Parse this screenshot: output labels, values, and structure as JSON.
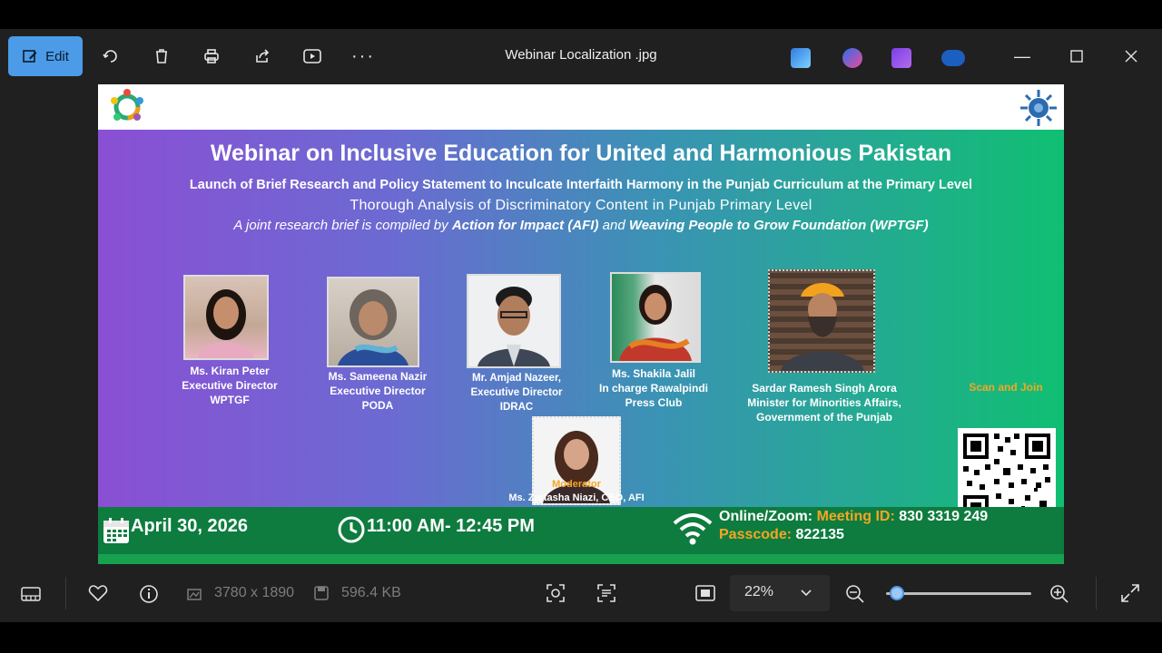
{
  "window": {
    "title": "Webinar Localization .jpg"
  },
  "toolbar": {
    "edit_label": "Edit"
  },
  "image": {
    "title": "Webinar on Inclusive Education for United and Harmonious Pakistan",
    "subtitle": "Launch of Brief Research and Policy Statement to Inculcate Interfaith Harmony in the Punjab Curriculum at the Primary Level",
    "subtitle2": "Thorough Analysis of Discriminatory Content in Punjab Primary Level",
    "joint_prefix": "A joint research brief is compiled by",
    "joint_afi": "Action for Impact (AFI)",
    "joint_and": "and",
    "joint_wptgf": "Weaving People to Grow Foundation (WPTGF)",
    "speakers": [
      {
        "name": "Ms. Kiran Peter",
        "role": "Executive Director",
        "org": "WPTGF"
      },
      {
        "name": "Ms. Sameena Nazir",
        "role": "Executive Director",
        "org": "PODA"
      },
      {
        "name": "Mr. Amjad Nazeer,",
        "role": "Executive Director",
        "org": "IDRAC"
      },
      {
        "name": "Ms. Shakila Jalil",
        "role": "In charge Rawalpindi",
        "org": "Press Club"
      },
      {
        "name": "Sardar Ramesh Singh Arora",
        "role": "Minister for Minorities Affairs,",
        "org": "Government of the Punjab"
      }
    ],
    "moderator_label": "Moderator",
    "moderator_name": "Ms. Zartasha Niazi, CEO, AFI",
    "scan_label": "Scan and Join",
    "date": "April 30, 2026",
    "time": "11:00 AM- 12:45 PM",
    "online_label": "Online/Zoom:",
    "meeting_label": "Meeting ID:",
    "meeting_id": "830 3319 249",
    "passcode_label": "Passcode:",
    "passcode": "822135"
  },
  "status": {
    "dimensions": "3780 x 1890",
    "file_size": "596.4 KB",
    "zoom": "22%"
  },
  "colors": {
    "accent": "#4c9be8",
    "orange": "#f5a623",
    "footer": "#0e7c3f"
  }
}
